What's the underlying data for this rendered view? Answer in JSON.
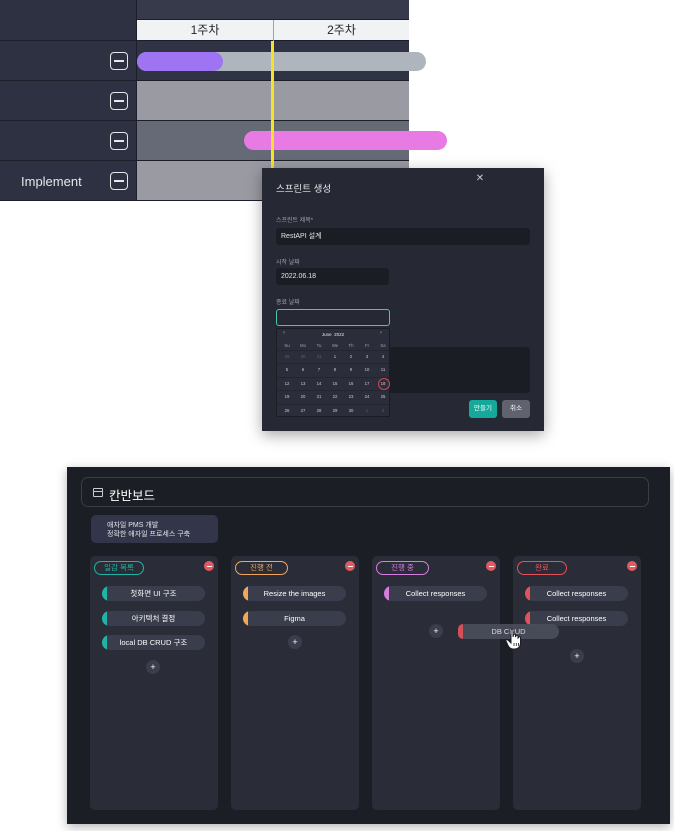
{
  "gantt": {
    "weeks": [
      "1주차",
      "2주차"
    ],
    "rows": [
      {
        "label": "",
        "bars": [
          {
            "color": "#9f74f3"
          },
          {
            "color": "#aeb5bd"
          }
        ]
      },
      {
        "label": "",
        "bars": []
      },
      {
        "label": "",
        "bars": [
          {
            "color": "#e77ae3"
          }
        ]
      },
      {
        "label": "Implement",
        "bars": []
      }
    ],
    "colors": {
      "today_line": "#f7e326",
      "sidebar": "#2d3142"
    }
  },
  "sprint_modal": {
    "title": "스프린트 생성",
    "name_label": "스프린트 제목*",
    "name_value": "RestAPI 설계",
    "start_label": "시작 날짜",
    "start_value": "2022.06.18",
    "end_label": "종료 날짜",
    "end_value": "",
    "create_label": "만들기",
    "cancel_label": "취소",
    "calendar": {
      "month": "June",
      "year": "2022",
      "prev": "‹",
      "next": "›",
      "weekdays": [
        "Su",
        "Mo",
        "Tu",
        "We",
        "Th",
        "Fr",
        "Sa"
      ],
      "weeks": [
        [
          "29",
          "30",
          "31",
          "1",
          "2",
          "3",
          "4"
        ],
        [
          "5",
          "6",
          "7",
          "8",
          "9",
          "10",
          "11"
        ],
        [
          "12",
          "13",
          "14",
          "15",
          "16",
          "17",
          "18"
        ],
        [
          "19",
          "20",
          "21",
          "22",
          "23",
          "24",
          "25"
        ],
        [
          "26",
          "27",
          "28",
          "29",
          "30",
          "1",
          "2"
        ]
      ],
      "selected": "18"
    }
  },
  "kanban": {
    "title": "칸반보드",
    "project": {
      "name": "애자일 PMS 개발",
      "description": "정확한 애자일 프로세스 구축"
    },
    "columns": [
      {
        "title": "일감 목록",
        "color": "#1fb5a6",
        "tasks": [
          {
            "label": "첫화면 UI 구조",
            "color": "#1fb5a6"
          },
          {
            "label": "아키텍처 결정",
            "color": "#1fb5a6"
          },
          {
            "label": "local DB CRUD 구조",
            "color": "#1fb5a6"
          }
        ]
      },
      {
        "title": "진행 전",
        "color": "#f2a65a",
        "tasks": [
          {
            "label": "Resize the images",
            "color": "#f2a65a"
          },
          {
            "label": "Figma",
            "color": "#f2a65a"
          }
        ]
      },
      {
        "title": "진행 중",
        "color": "#d77de0",
        "tasks": [
          {
            "label": "Collect responses",
            "color": "#d77de0"
          }
        ]
      },
      {
        "title": "완료",
        "color": "#e3525b",
        "tasks": [
          {
            "label": "Collect responses",
            "color": "#e3525b"
          },
          {
            "label": "Collect responses",
            "color": "#e3525b"
          }
        ]
      }
    ],
    "add_label": "+",
    "dragging": {
      "label": "DB CRUD",
      "color": "#e3525b"
    }
  }
}
